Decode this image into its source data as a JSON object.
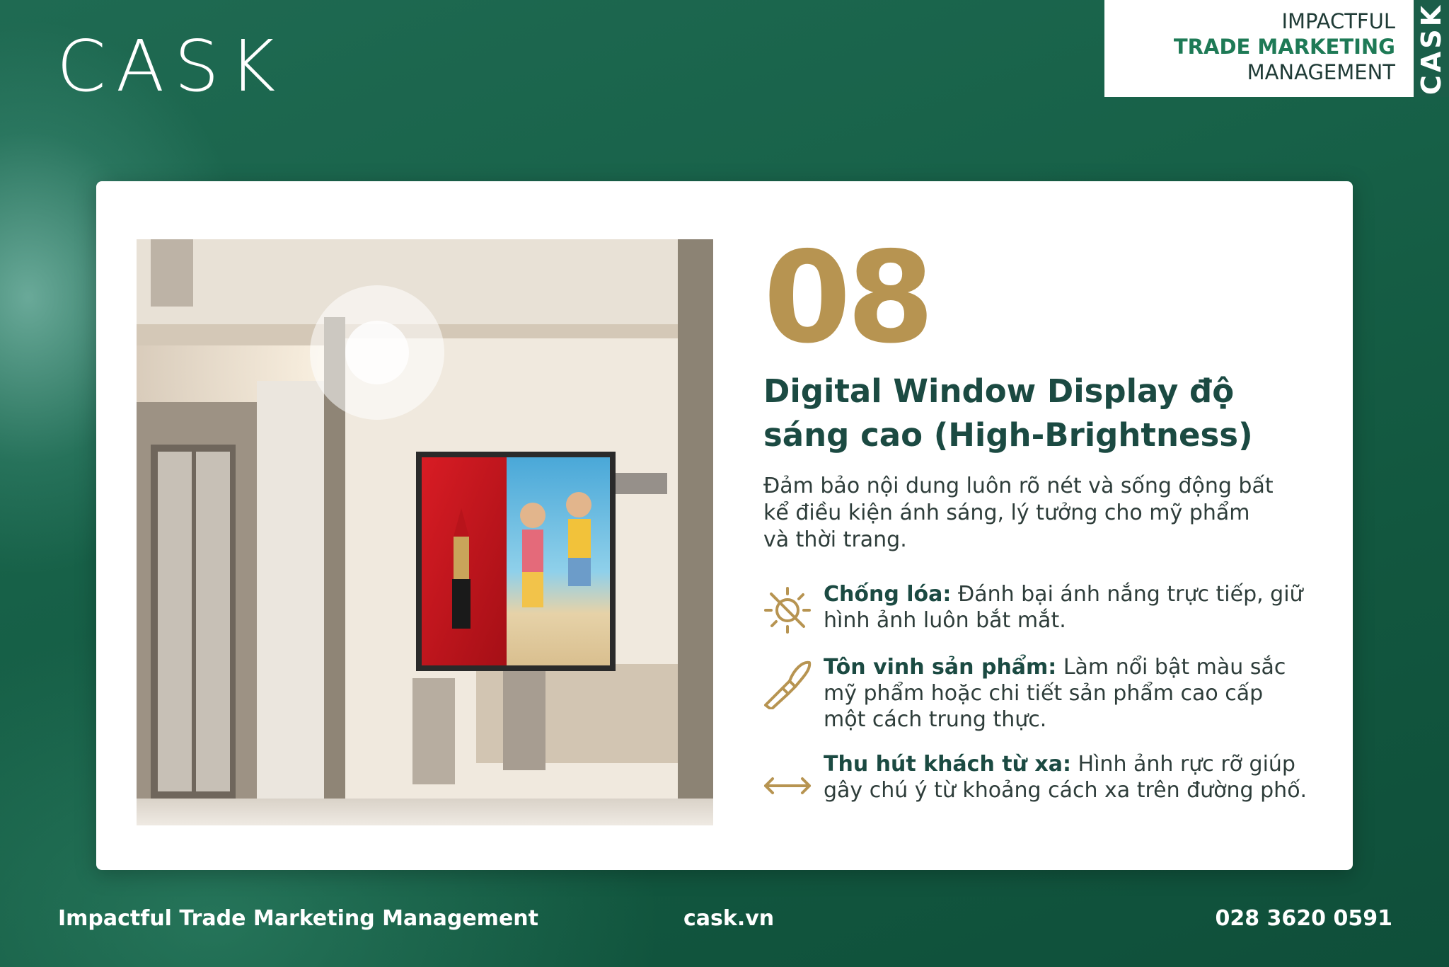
{
  "brand": {
    "logo": "CASK"
  },
  "badge": {
    "line1": "IMPACTFUL",
    "line2": "TRADE MARKETING",
    "line3": "MANAGEMENT",
    "vertical": "CASK"
  },
  "slide": {
    "number": "08",
    "title": "Digital Window Display độ sáng cao (High-Brightness)",
    "description": "Đảm bảo nội dung luôn rõ nét và sống động bất kể điều kiện ánh sáng, lý tưởng cho mỹ phẩm và thời trang.",
    "features": [
      {
        "icon": "sun-glare-icon",
        "label": "Chống lóa:",
        "text": " Đánh bại ánh nắng trực tiếp, giữ hình ảnh luôn bắt mắt."
      },
      {
        "icon": "makeup-brush-icon",
        "label": "Tôn vinh sản phẩm:",
        "text": " Làm nổi bật màu sắc mỹ phẩm hoặc chi tiết sản phẩm cao cấp một cách trung thực."
      },
      {
        "icon": "double-arrow-icon",
        "label": "Thu hút khách từ xa:",
        "text": " Hình ảnh rực rỡ giúp gây chú ý từ khoảng cách xa trên đường phố."
      }
    ]
  },
  "footer": {
    "tagline": "Impactful Trade Marketing Management",
    "website": "cask.vn",
    "phone": "028 3620 0591"
  },
  "colors": {
    "background": "#176148",
    "gold": "#b79451",
    "title": "#1b4a42",
    "badge_green": "#1e7a56"
  }
}
